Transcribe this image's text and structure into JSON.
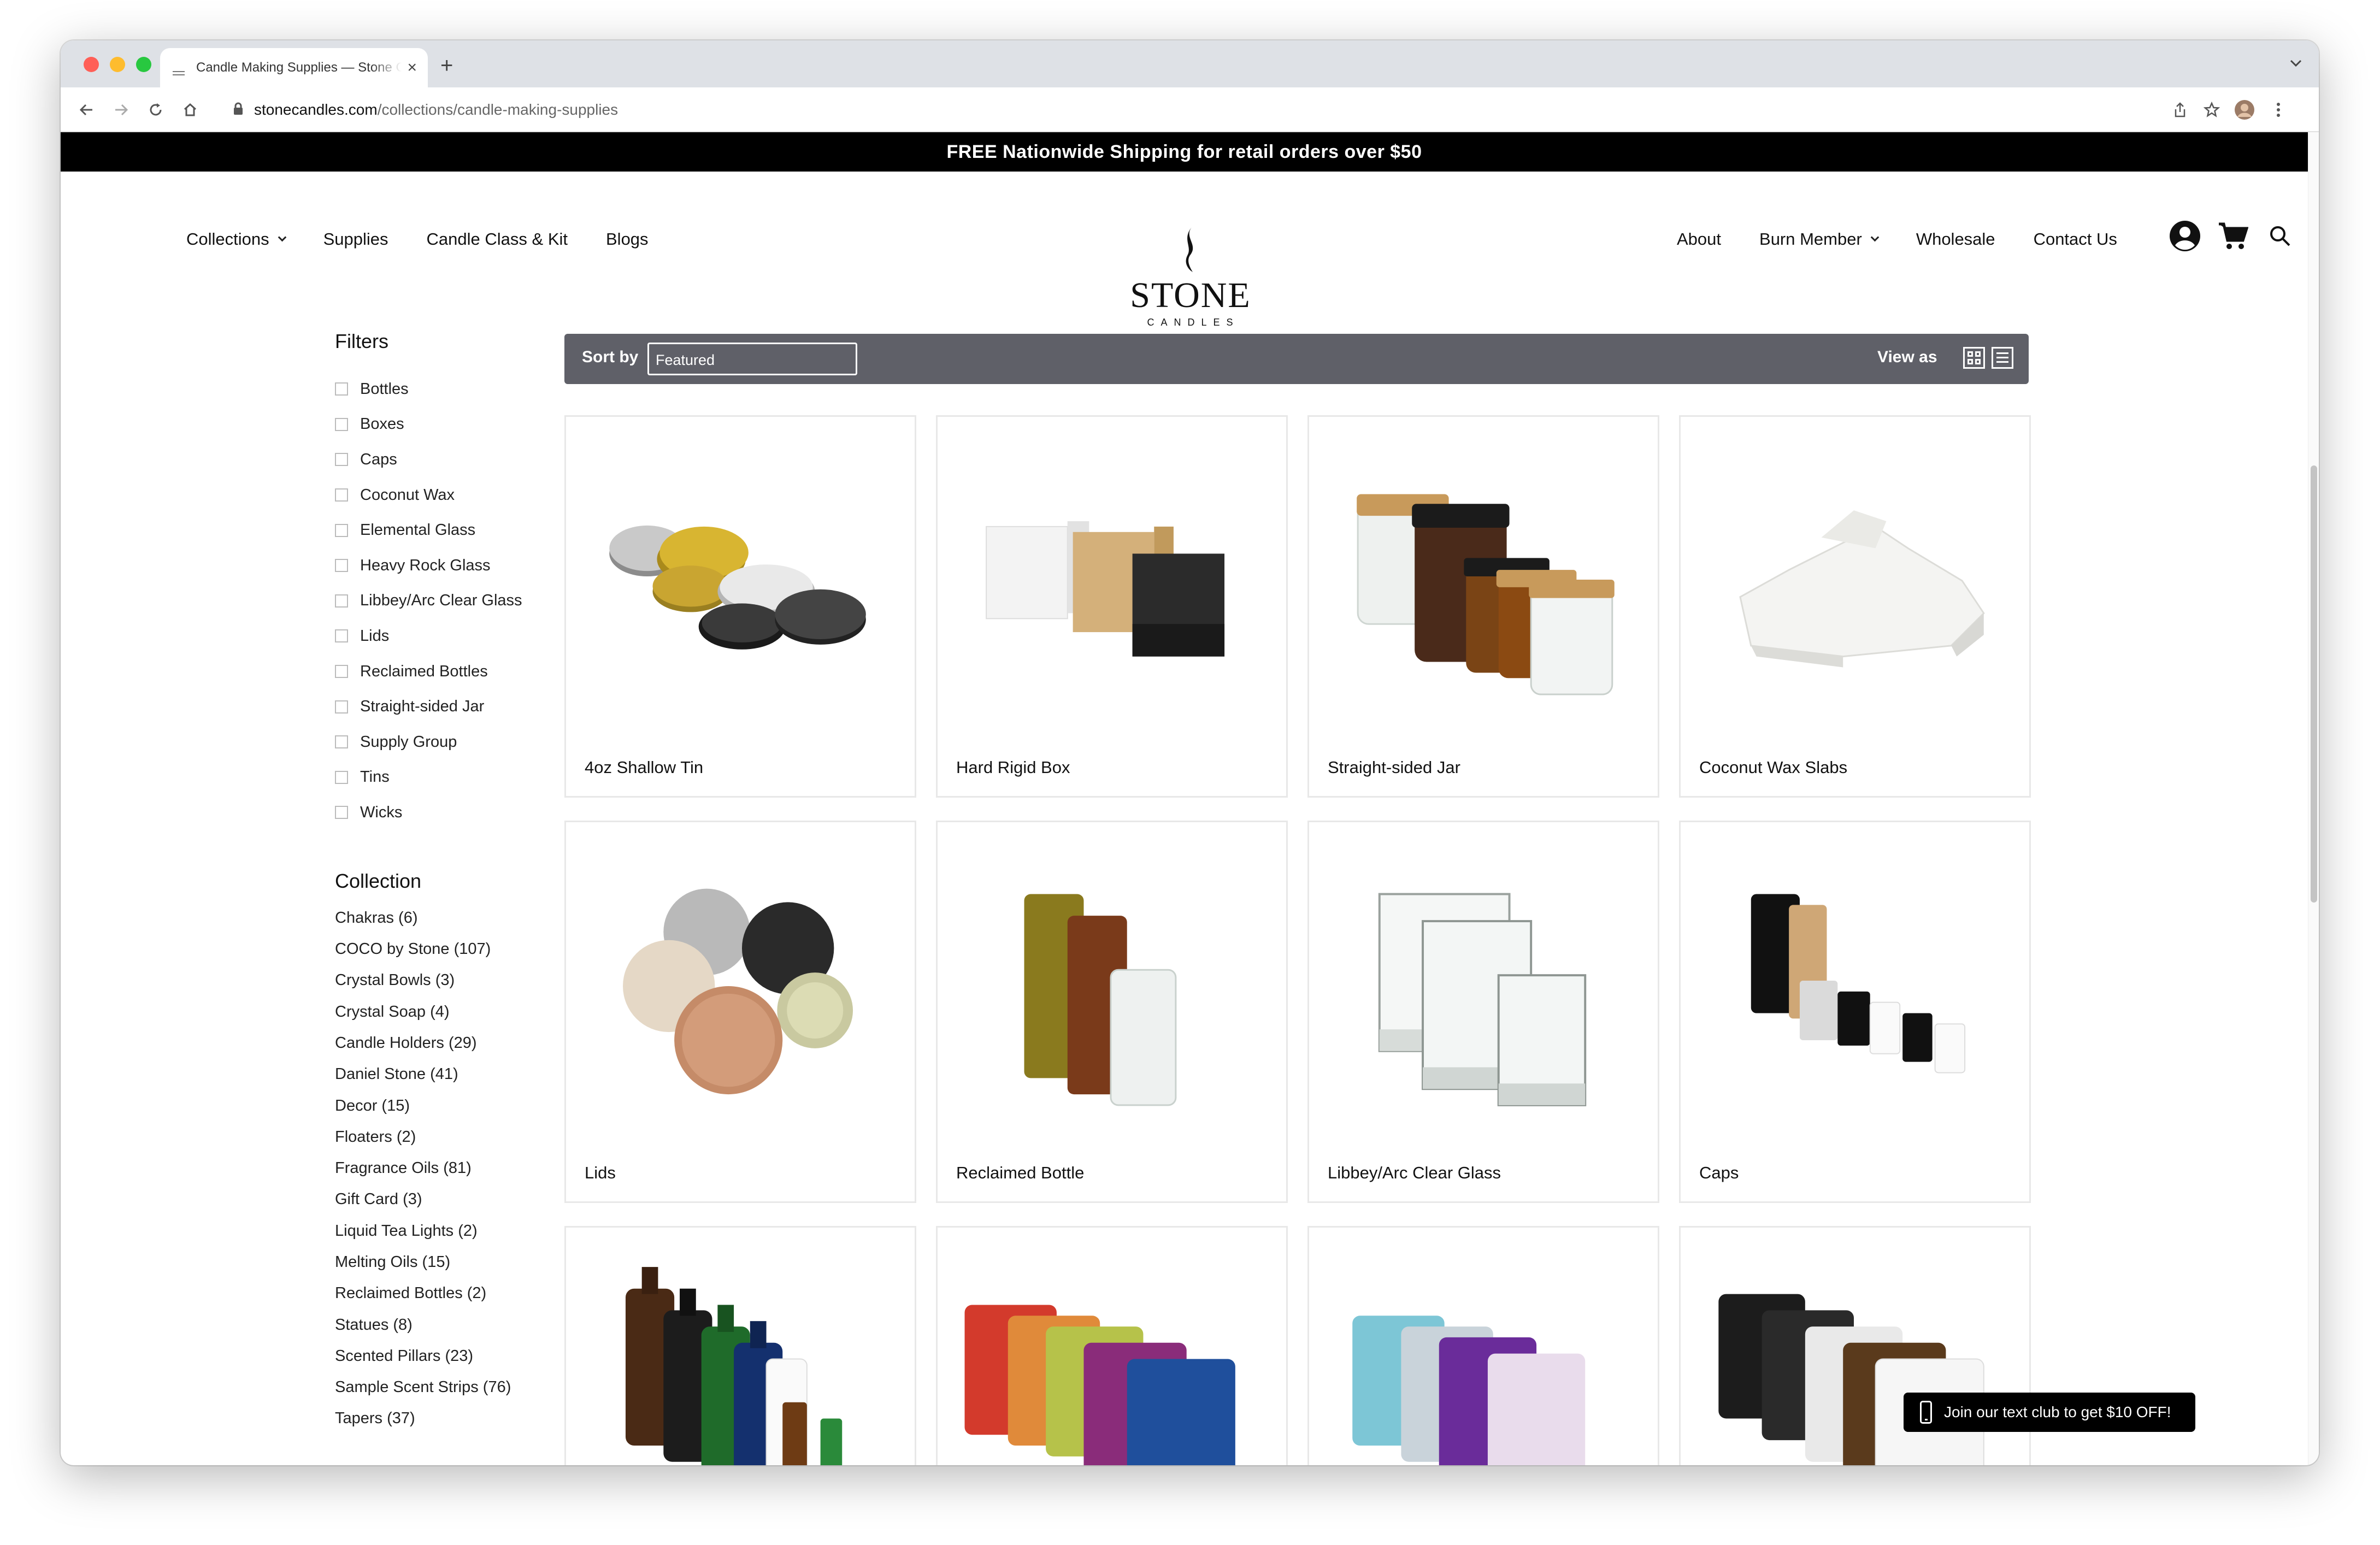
{
  "browser": {
    "tab_title": "Candle Making Supplies — Stone Candles",
    "new_tab": "+",
    "tab_close": "×",
    "url_host": "stonecandles.com",
    "url_path": "/collections/candle-making-supplies"
  },
  "announcement": "FREE Nationwide Shipping for retail orders over $50",
  "nav": {
    "left": [
      {
        "label": "Collections",
        "dropdown": true
      },
      {
        "label": "Supplies",
        "dropdown": false
      },
      {
        "label": "Candle Class & Kit",
        "dropdown": false
      },
      {
        "label": "Blogs",
        "dropdown": false
      }
    ],
    "right": [
      {
        "label": "About",
        "dropdown": false
      },
      {
        "label": "Burn Member",
        "dropdown": true
      },
      {
        "label": "Wholesale",
        "dropdown": false
      },
      {
        "label": "Contact Us",
        "dropdown": false
      }
    ]
  },
  "logo": {
    "word": "STONE",
    "sub": "CANDLES"
  },
  "filters": {
    "heading": "Filters",
    "items": [
      "Bottles",
      "Boxes",
      "Caps",
      "Coconut Wax",
      "Elemental Glass",
      "Heavy Rock Glass",
      "Libbey/Arc Clear Glass",
      "Lids",
      "Reclaimed Bottles",
      "Straight-sided Jar",
      "Supply Group",
      "Tins",
      "Wicks"
    ]
  },
  "collection": {
    "heading": "Collection",
    "items": [
      "Chakras (6)",
      "COCO by Stone (107)",
      "Crystal Bowls (3)",
      "Crystal Soap (4)",
      "Candle Holders (29)",
      "Daniel Stone (41)",
      "Decor (15)",
      "Floaters (2)",
      "Fragrance Oils (81)",
      "Gift Card (3)",
      "Liquid Tea Lights (2)",
      "Melting Oils (15)",
      "Reclaimed Bottles (2)",
      "Statues (8)",
      "Scented Pillars (23)",
      "Sample Scent Strips (76)",
      "Tapers (37)"
    ]
  },
  "sortbar": {
    "sort_label": "Sort by",
    "sort_value": "Featured",
    "view_label": "View as"
  },
  "products": [
    {
      "name": "4oz Shallow Tin"
    },
    {
      "name": "Hard Rigid Box"
    },
    {
      "name": "Straight-sided Jar"
    },
    {
      "name": "Coconut Wax Slabs"
    },
    {
      "name": "Lids"
    },
    {
      "name": "Reclaimed Bottle"
    },
    {
      "name": "Libbey/Arc Clear Glass"
    },
    {
      "name": "Caps"
    },
    {
      "name": ""
    },
    {
      "name": ""
    },
    {
      "name": ""
    },
    {
      "name": ""
    }
  ],
  "textclub": "Join our text club to get $10 OFF!",
  "colors": {
    "announce_bg": "#000000",
    "sortbar_bg": "#5f6068",
    "accent": "#111111"
  }
}
